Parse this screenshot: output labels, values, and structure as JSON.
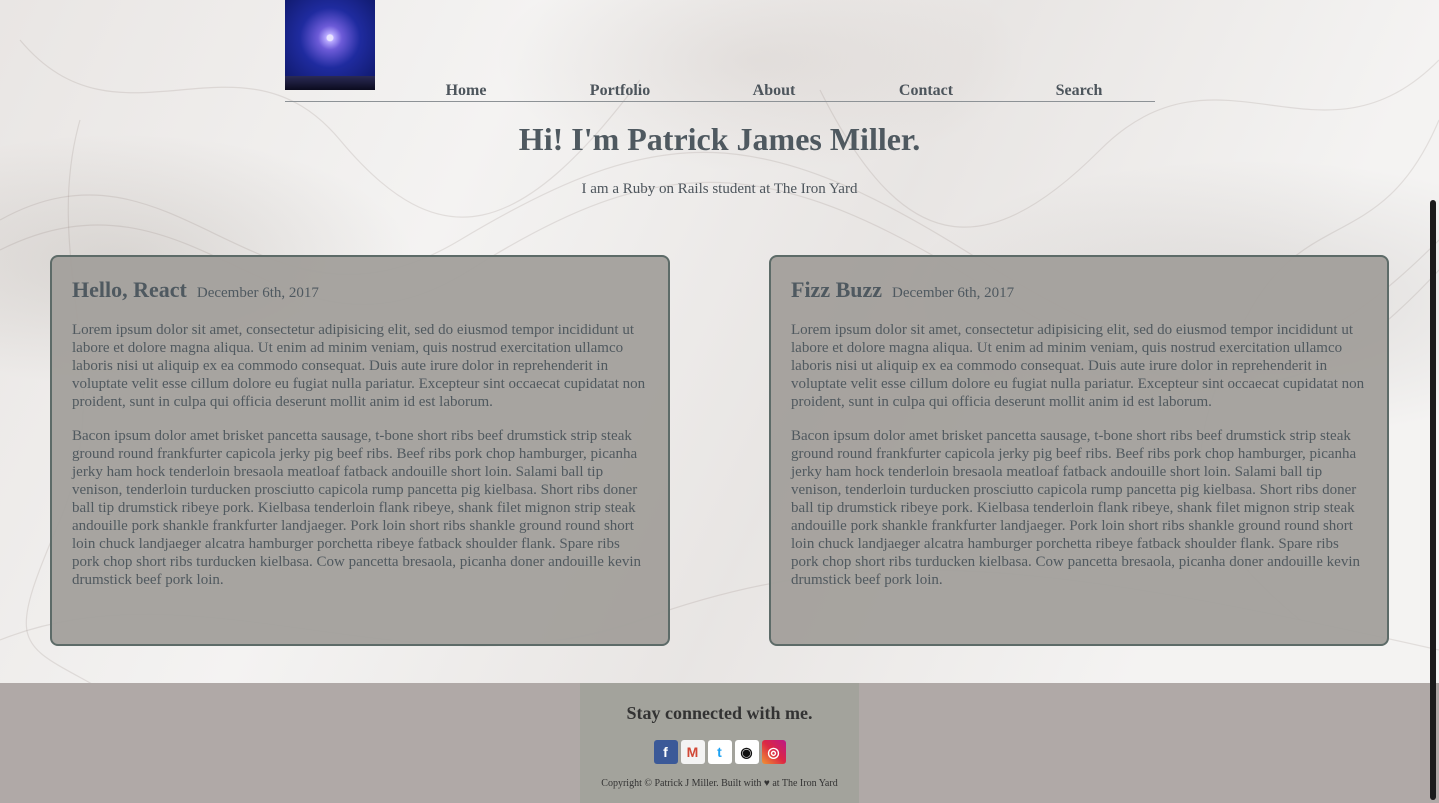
{
  "nav": {
    "items": [
      {
        "label": "Home"
      },
      {
        "label": "Portfolio"
      },
      {
        "label": "About"
      },
      {
        "label": "Contact"
      },
      {
        "label": "Search"
      }
    ]
  },
  "hero": {
    "title": "Hi! I'm Patrick James Miller.",
    "subtitle": "I am a Ruby on Rails student at The Iron Yard"
  },
  "posts": [
    {
      "title": "Hello, React",
      "date": "December 6th, 2017",
      "paragraphs": [
        "Lorem ipsum dolor sit amet, consectetur adipisicing elit, sed do eiusmod tempor incididunt ut labore et dolore magna aliqua. Ut enim ad minim veniam, quis nostrud exercitation ullamco laboris nisi ut aliquip ex ea commodo consequat. Duis aute irure dolor in reprehenderit in voluptate velit esse cillum dolore eu fugiat nulla pariatur. Excepteur sint occaecat cupidatat non proident, sunt in culpa qui officia deserunt mollit anim id est laborum.",
        "Bacon ipsum dolor amet brisket pancetta sausage, t-bone short ribs beef drumstick strip steak ground round frankfurter capicola jerky pig beef ribs. Beef ribs pork chop hamburger, picanha jerky ham hock tenderloin bresaola meatloaf fatback andouille short loin. Salami ball tip venison, tenderloin turducken prosciutto capicola rump pancetta pig kielbasa. Short ribs doner ball tip drumstick ribeye pork. Kielbasa tenderloin flank ribeye, shank filet mignon strip steak andouille pork shankle frankfurter landjaeger. Pork loin short ribs shankle ground round short loin chuck landjaeger alcatra hamburger porchetta ribeye fatback shoulder flank. Spare ribs pork chop short ribs turducken kielbasa. Cow pancetta bresaola, picanha doner andouille kevin drumstick beef pork loin."
      ]
    },
    {
      "title": "Fizz Buzz",
      "date": "December 6th, 2017",
      "paragraphs": [
        "Lorem ipsum dolor sit amet, consectetur adipisicing elit, sed do eiusmod tempor incididunt ut labore et dolore magna aliqua. Ut enim ad minim veniam, quis nostrud exercitation ullamco laboris nisi ut aliquip ex ea commodo consequat. Duis aute irure dolor in reprehenderit in voluptate velit esse cillum dolore eu fugiat nulla pariatur. Excepteur sint occaecat cupidatat non proident, sunt in culpa qui officia deserunt mollit anim id est laborum.",
        "Bacon ipsum dolor amet brisket pancetta sausage, t-bone short ribs beef drumstick strip steak ground round frankfurter capicola jerky pig beef ribs. Beef ribs pork chop hamburger, picanha jerky ham hock tenderloin bresaola meatloaf fatback andouille short loin. Salami ball tip venison, tenderloin turducken prosciutto capicola rump pancetta pig kielbasa. Short ribs doner ball tip drumstick ribeye pork. Kielbasa tenderloin flank ribeye, shank filet mignon strip steak andouille pork shankle frankfurter landjaeger. Pork loin short ribs shankle ground round short loin chuck landjaeger alcatra hamburger porchetta ribeye fatback shoulder flank. Spare ribs pork chop short ribs turducken kielbasa. Cow pancetta bresaola, picanha doner andouille kevin drumstick beef pork loin."
      ]
    }
  ],
  "footer": {
    "heading": "Stay connected with me.",
    "social": [
      {
        "icon": "facebook-icon",
        "glyph": "f"
      },
      {
        "icon": "gmail-icon",
        "glyph": "M"
      },
      {
        "icon": "twitter-icon",
        "glyph": "t"
      },
      {
        "icon": "github-icon",
        "glyph": "◉"
      },
      {
        "icon": "instagram-icon",
        "glyph": "◎"
      }
    ],
    "copyright": "Copyright © Patrick J Miller. Built with ♥ at The Iron Yard"
  },
  "colors": {
    "text": "#4d555c",
    "card_bg": "#a3a09c",
    "card_border": "#5d6b68",
    "footer_bg": "#b0a9a7",
    "footer_inner_bg": "#a3a39c"
  }
}
